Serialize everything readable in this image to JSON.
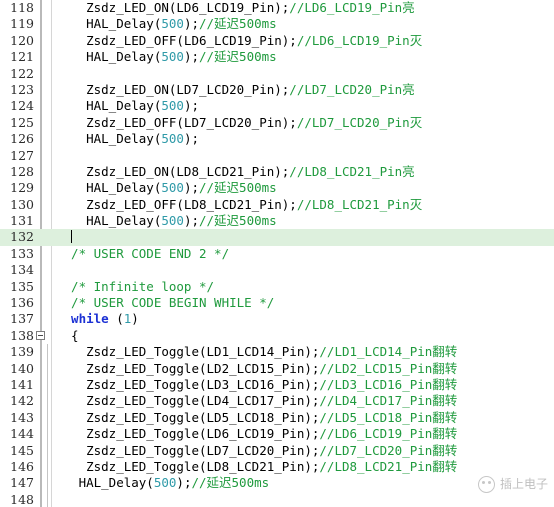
{
  "editor": {
    "language": "c",
    "colors": {
      "background": "#ffffff",
      "gutter_text": "#2b2b2b",
      "comment": "#1f9a3d",
      "number": "#2f9aa8",
      "keyword": "#1c31d4",
      "current_line_highlight": "#ddf0dd",
      "separator": "#b9b9b9"
    },
    "current_line": 132,
    "first_visible_line": 118,
    "last_visible_line": 148,
    "lines": [
      {
        "number": 118,
        "indent": 4,
        "fold": false,
        "segments": [
          {
            "type": "plain",
            "text": "Zsdz_LED_ON(LD6_LCD19_Pin);"
          },
          {
            "type": "comment",
            "text": "//LD6_LCD19_Pin亮"
          }
        ]
      },
      {
        "number": 119,
        "indent": 4,
        "fold": false,
        "segments": [
          {
            "type": "plain",
            "text": "HAL_Delay("
          },
          {
            "type": "number",
            "text": "500"
          },
          {
            "type": "plain",
            "text": ");"
          },
          {
            "type": "comment",
            "text": "//延迟500ms"
          }
        ]
      },
      {
        "number": 120,
        "indent": 4,
        "fold": false,
        "segments": [
          {
            "type": "plain",
            "text": "Zsdz_LED_OFF(LD6_LCD19_Pin);"
          },
          {
            "type": "comment",
            "text": "//LD6_LCD19_Pin灭"
          }
        ]
      },
      {
        "number": 121,
        "indent": 4,
        "fold": false,
        "segments": [
          {
            "type": "plain",
            "text": "HAL_Delay("
          },
          {
            "type": "number",
            "text": "500"
          },
          {
            "type": "plain",
            "text": ");"
          },
          {
            "type": "comment",
            "text": "//延迟500ms"
          }
        ]
      },
      {
        "number": 122,
        "indent": 0,
        "fold": false,
        "segments": []
      },
      {
        "number": 123,
        "indent": 4,
        "fold": false,
        "segments": [
          {
            "type": "plain",
            "text": "Zsdz_LED_ON(LD7_LCD20_Pin);"
          },
          {
            "type": "comment",
            "text": "//LD7_LCD20_Pin亮"
          }
        ]
      },
      {
        "number": 124,
        "indent": 4,
        "fold": false,
        "segments": [
          {
            "type": "plain",
            "text": "HAL_Delay("
          },
          {
            "type": "number",
            "text": "500"
          },
          {
            "type": "plain",
            "text": ");"
          }
        ]
      },
      {
        "number": 125,
        "indent": 4,
        "fold": false,
        "segments": [
          {
            "type": "plain",
            "text": "Zsdz_LED_OFF(LD7_LCD20_Pin);"
          },
          {
            "type": "comment",
            "text": "//LD7_LCD20_Pin灭"
          }
        ]
      },
      {
        "number": 126,
        "indent": 4,
        "fold": false,
        "segments": [
          {
            "type": "plain",
            "text": "HAL_Delay("
          },
          {
            "type": "number",
            "text": "500"
          },
          {
            "type": "plain",
            "text": ");"
          }
        ]
      },
      {
        "number": 127,
        "indent": 0,
        "fold": false,
        "segments": []
      },
      {
        "number": 128,
        "indent": 4,
        "fold": false,
        "segments": [
          {
            "type": "plain",
            "text": "Zsdz_LED_ON(LD8_LCD21_Pin);"
          },
          {
            "type": "comment",
            "text": "//LD8_LCD21_Pin亮"
          }
        ]
      },
      {
        "number": 129,
        "indent": 4,
        "fold": false,
        "segments": [
          {
            "type": "plain",
            "text": "HAL_Delay("
          },
          {
            "type": "number",
            "text": "500"
          },
          {
            "type": "plain",
            "text": ");"
          },
          {
            "type": "comment",
            "text": "//延迟500ms"
          }
        ]
      },
      {
        "number": 130,
        "indent": 4,
        "fold": false,
        "segments": [
          {
            "type": "plain",
            "text": "Zsdz_LED_OFF(LD8_LCD21_Pin);"
          },
          {
            "type": "comment",
            "text": "//LD8_LCD21_Pin灭"
          }
        ]
      },
      {
        "number": 131,
        "indent": 4,
        "fold": false,
        "segments": [
          {
            "type": "plain",
            "text": "HAL_Delay("
          },
          {
            "type": "number",
            "text": "500"
          },
          {
            "type": "plain",
            "text": ");"
          },
          {
            "type": "comment",
            "text": "//延迟500ms"
          }
        ]
      },
      {
        "number": 132,
        "indent": 2,
        "fold": false,
        "cursor": true,
        "segments": []
      },
      {
        "number": 133,
        "indent": 2,
        "fold": false,
        "segments": [
          {
            "type": "comment",
            "text": "/* USER CODE END 2 */"
          }
        ]
      },
      {
        "number": 134,
        "indent": 0,
        "fold": false,
        "segments": []
      },
      {
        "number": 135,
        "indent": 2,
        "fold": false,
        "segments": [
          {
            "type": "comment",
            "text": "/* Infinite loop */"
          }
        ]
      },
      {
        "number": 136,
        "indent": 2,
        "fold": false,
        "segments": [
          {
            "type": "comment",
            "text": "/* USER CODE BEGIN WHILE */"
          }
        ]
      },
      {
        "number": 137,
        "indent": 2,
        "fold": false,
        "segments": [
          {
            "type": "keyword",
            "text": "while"
          },
          {
            "type": "plain",
            "text": " ("
          },
          {
            "type": "number",
            "text": "1"
          },
          {
            "type": "plain",
            "text": ")"
          }
        ]
      },
      {
        "number": 138,
        "indent": 2,
        "fold": true,
        "segments": [
          {
            "type": "plain",
            "text": "{"
          }
        ]
      },
      {
        "number": 139,
        "indent": 4,
        "fold": false,
        "segments": [
          {
            "type": "plain",
            "text": "Zsdz_LED_Toggle(LD1_LCD14_Pin);"
          },
          {
            "type": "comment",
            "text": "//LD1_LCD14_Pin翻转"
          }
        ]
      },
      {
        "number": 140,
        "indent": 4,
        "fold": false,
        "segments": [
          {
            "type": "plain",
            "text": "Zsdz_LED_Toggle(LD2_LCD15_Pin);"
          },
          {
            "type": "comment",
            "text": "//LD2_LCD15_Pin翻转"
          }
        ]
      },
      {
        "number": 141,
        "indent": 4,
        "fold": false,
        "segments": [
          {
            "type": "plain",
            "text": "Zsdz_LED_Toggle(LD3_LCD16_Pin);"
          },
          {
            "type": "comment",
            "text": "//LD3_LCD16_Pin翻转"
          }
        ]
      },
      {
        "number": 142,
        "indent": 4,
        "fold": false,
        "segments": [
          {
            "type": "plain",
            "text": "Zsdz_LED_Toggle(LD4_LCD17_Pin);"
          },
          {
            "type": "comment",
            "text": "//LD4_LCD17_Pin翻转"
          }
        ]
      },
      {
        "number": 143,
        "indent": 4,
        "fold": false,
        "segments": [
          {
            "type": "plain",
            "text": "Zsdz_LED_Toggle(LD5_LCD18_Pin);"
          },
          {
            "type": "comment",
            "text": "//LD5_LCD18_Pin翻转"
          }
        ]
      },
      {
        "number": 144,
        "indent": 4,
        "fold": false,
        "segments": [
          {
            "type": "plain",
            "text": "Zsdz_LED_Toggle(LD6_LCD19_Pin);"
          },
          {
            "type": "comment",
            "text": "//LD6_LCD19_Pin翻转"
          }
        ]
      },
      {
        "number": 145,
        "indent": 4,
        "fold": false,
        "segments": [
          {
            "type": "plain",
            "text": "Zsdz_LED_Toggle(LD7_LCD20_Pin);"
          },
          {
            "type": "comment",
            "text": "//LD7_LCD20_Pin翻转"
          }
        ]
      },
      {
        "number": 146,
        "indent": 4,
        "fold": false,
        "segments": [
          {
            "type": "plain",
            "text": "Zsdz_LED_Toggle(LD8_LCD21_Pin);"
          },
          {
            "type": "comment",
            "text": "//LD8_LCD21_Pin翻转"
          }
        ]
      },
      {
        "number": 147,
        "indent": 3,
        "fold": false,
        "segments": [
          {
            "type": "plain",
            "text": "HAL_Delay("
          },
          {
            "type": "number",
            "text": "500"
          },
          {
            "type": "plain",
            "text": ");"
          },
          {
            "type": "comment",
            "text": "//延迟500ms"
          }
        ]
      },
      {
        "number": 148,
        "indent": 0,
        "fold": false,
        "segments": []
      }
    ]
  },
  "watermark": {
    "text": "插上电子",
    "icon": "wechat-logo-icon"
  }
}
